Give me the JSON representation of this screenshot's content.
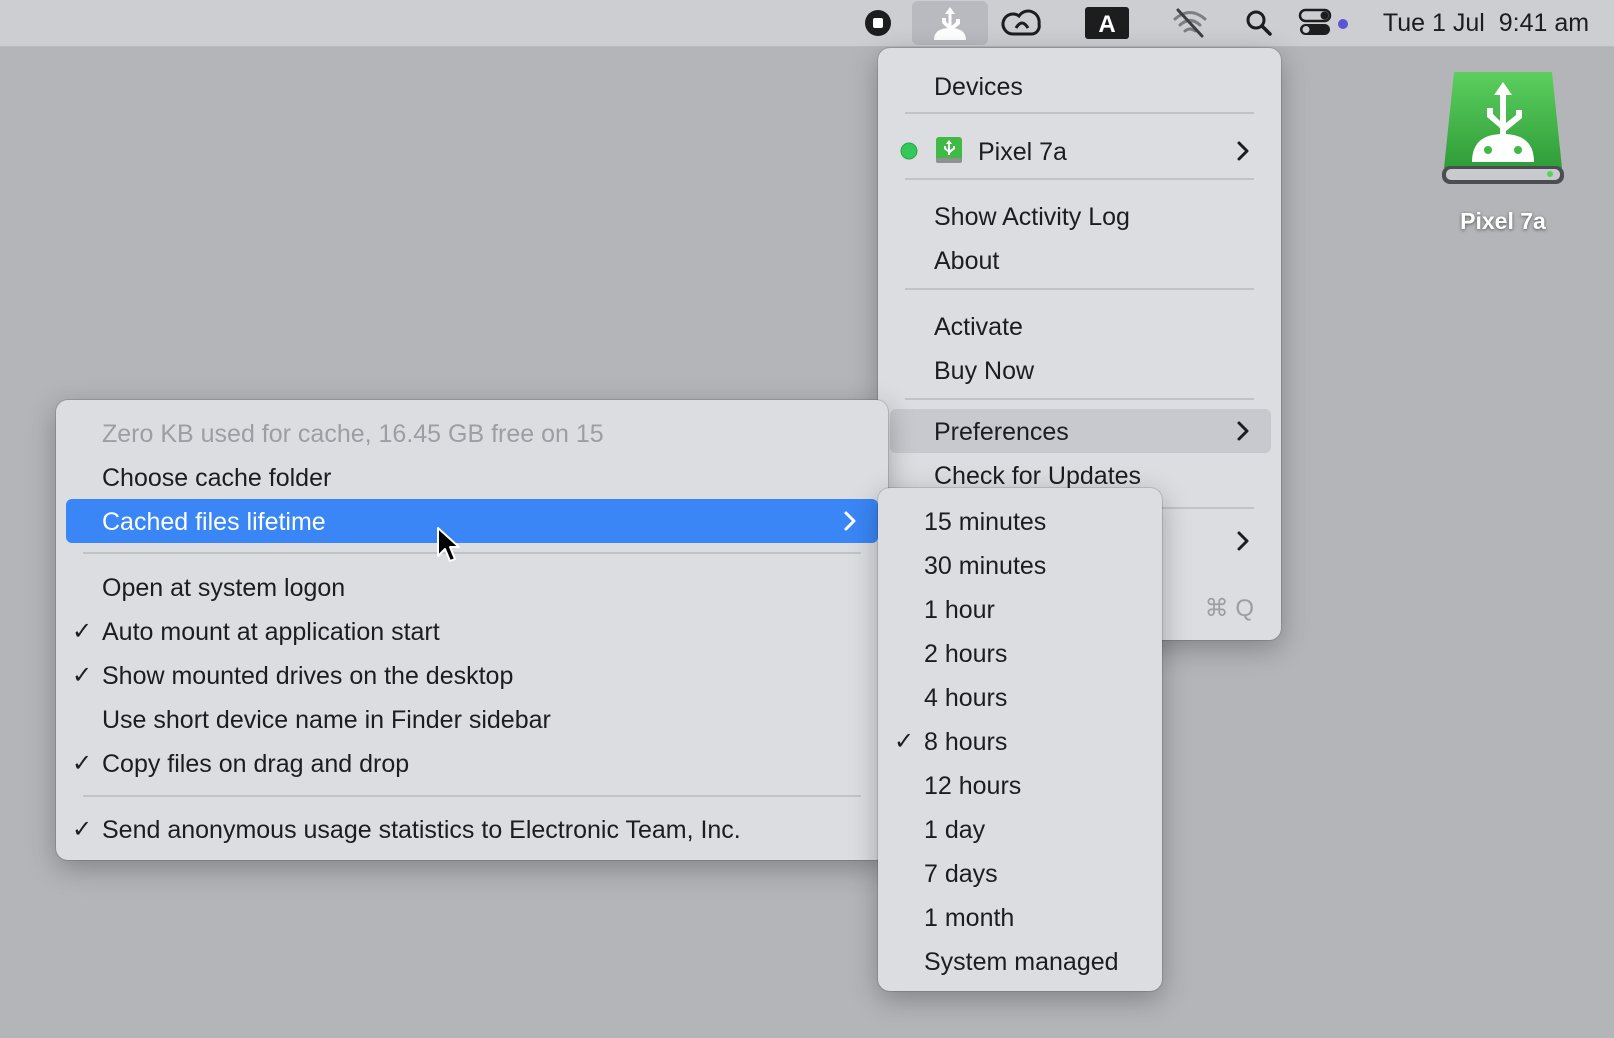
{
  "menubar": {
    "icons": [
      "stop-circle-icon",
      "app-usb-icon",
      "creative-cloud-icon",
      "font-a-icon",
      "wifi-off-icon",
      "search-icon",
      "control-center-icon"
    ],
    "clock": {
      "date": "Tue 1 Jul",
      "time": "9:41 am"
    }
  },
  "desktop": {
    "drive": {
      "label": "Pixel 7a",
      "icon": "usb-drive-icon"
    }
  },
  "app_menu": {
    "header": "Devices",
    "device": {
      "name": "Pixel 7a",
      "status_color": "#34c759"
    },
    "items": [
      {
        "label": "Show Activity Log"
      },
      {
        "label": "About"
      },
      {
        "label": "Activate"
      },
      {
        "label": "Buy Now"
      },
      {
        "label": "Preferences"
      },
      {
        "label": "Check for Updates"
      }
    ],
    "quit_shortcut": "⌘ Q"
  },
  "preferences_menu": {
    "info": "Zero KB used for cache, 16.45 GB free on 15",
    "items": [
      {
        "label": "Choose cache folder",
        "checked": false
      },
      {
        "label": "Cached files lifetime",
        "checked": false,
        "highlighted": true
      },
      {
        "label": "Open at system logon",
        "checked": false
      },
      {
        "label": "Auto mount at application start",
        "checked": true
      },
      {
        "label": "Show mounted drives on the desktop",
        "checked": true
      },
      {
        "label": "Use short device name in Finder sidebar",
        "checked": false
      },
      {
        "label": "Copy files on drag and drop",
        "checked": true
      },
      {
        "label": "Send anonymous usage statistics to Electronic Team, Inc.",
        "checked": true
      }
    ],
    "check_mark": "✓"
  },
  "lifetime_menu": {
    "options": [
      {
        "label": "15 minutes",
        "checked": false
      },
      {
        "label": "30 minutes",
        "checked": false
      },
      {
        "label": "1 hour",
        "checked": false
      },
      {
        "label": "2 hours",
        "checked": false
      },
      {
        "label": "4 hours",
        "checked": false
      },
      {
        "label": "8 hours",
        "checked": true
      },
      {
        "label": "12 hours",
        "checked": false
      },
      {
        "label": "1 day",
        "checked": false
      },
      {
        "label": "7 days",
        "checked": false
      },
      {
        "label": "1 month",
        "checked": false
      },
      {
        "label": "System managed",
        "checked": false
      }
    ],
    "selected": "8 hours"
  },
  "colors": {
    "highlight_blue": "#3a86f6",
    "menu_bg": "#dcdde1",
    "desktop_bg": "#b4b5b9",
    "drive_green": "#3fba45"
  }
}
